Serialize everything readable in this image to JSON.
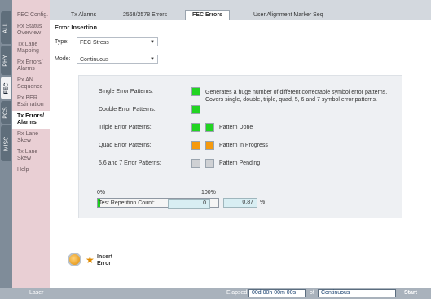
{
  "vertical_tabs": [
    "ALL",
    "PHY",
    "FEC",
    "PCS",
    "MISC"
  ],
  "sidebar": {
    "items": [
      "FEC Config.",
      "Rx Status Overview",
      "Tx Lane Mapping",
      "Rx Errors/ Alarms",
      "Rx AN Sequence",
      "Rx BER Estimation",
      "Tx Errors/ Alarms",
      "Rx Lane Skew",
      "Tx Lane Skew",
      "Help"
    ]
  },
  "tabs": [
    "Tx Alarms",
    "2568/2578 Errors",
    "FEC Errors",
    "User Alignment Marker Seq"
  ],
  "section_title": "Error Insertion",
  "type": {
    "label": "Type:",
    "value": "FEC Stress"
  },
  "mode": {
    "label": "Mode:",
    "value": "Continuous"
  },
  "patterns": [
    {
      "label": "Single Error Patterns:",
      "status": "done"
    },
    {
      "label": "Double Error Patterns:",
      "status": "done"
    },
    {
      "label": "Triple Error Patterns:",
      "status": "done"
    },
    {
      "label": "Quad Error Patterns:",
      "status": "in_progress"
    },
    {
      "label": "5,6 and 7 Error Patterns:",
      "status": "pending"
    }
  ],
  "description": "Generates a huge number of different correctable symbol error patterns. Covers single, double, triple, quad, 5, 6 and 7 symbol error patterns.",
  "legend": [
    {
      "label": "Pattern Done",
      "status": "done"
    },
    {
      "label": "Pattern in Progress",
      "status": "in_progress"
    },
    {
      "label": "Pattern Pending",
      "status": "pending"
    }
  ],
  "colors": {
    "done": "#22d422",
    "in_progress": "#f59a0e",
    "pending": "#cfd1d4"
  },
  "progress": {
    "min_label": "0%",
    "max_label": "100%",
    "value": "0.87",
    "unit": "%",
    "fraction": 0.0087
  },
  "repetition": {
    "label": "Test Repetition Count:",
    "value": "0"
  },
  "insert_error": "Insert Error",
  "bottom": {
    "laser": "Laser",
    "elapsed_label": "Elapsed:",
    "elapsed_value": "00d 00h 00m 00s",
    "of_label": "of",
    "duration_value": "Continuous",
    "start_label": "Start"
  }
}
